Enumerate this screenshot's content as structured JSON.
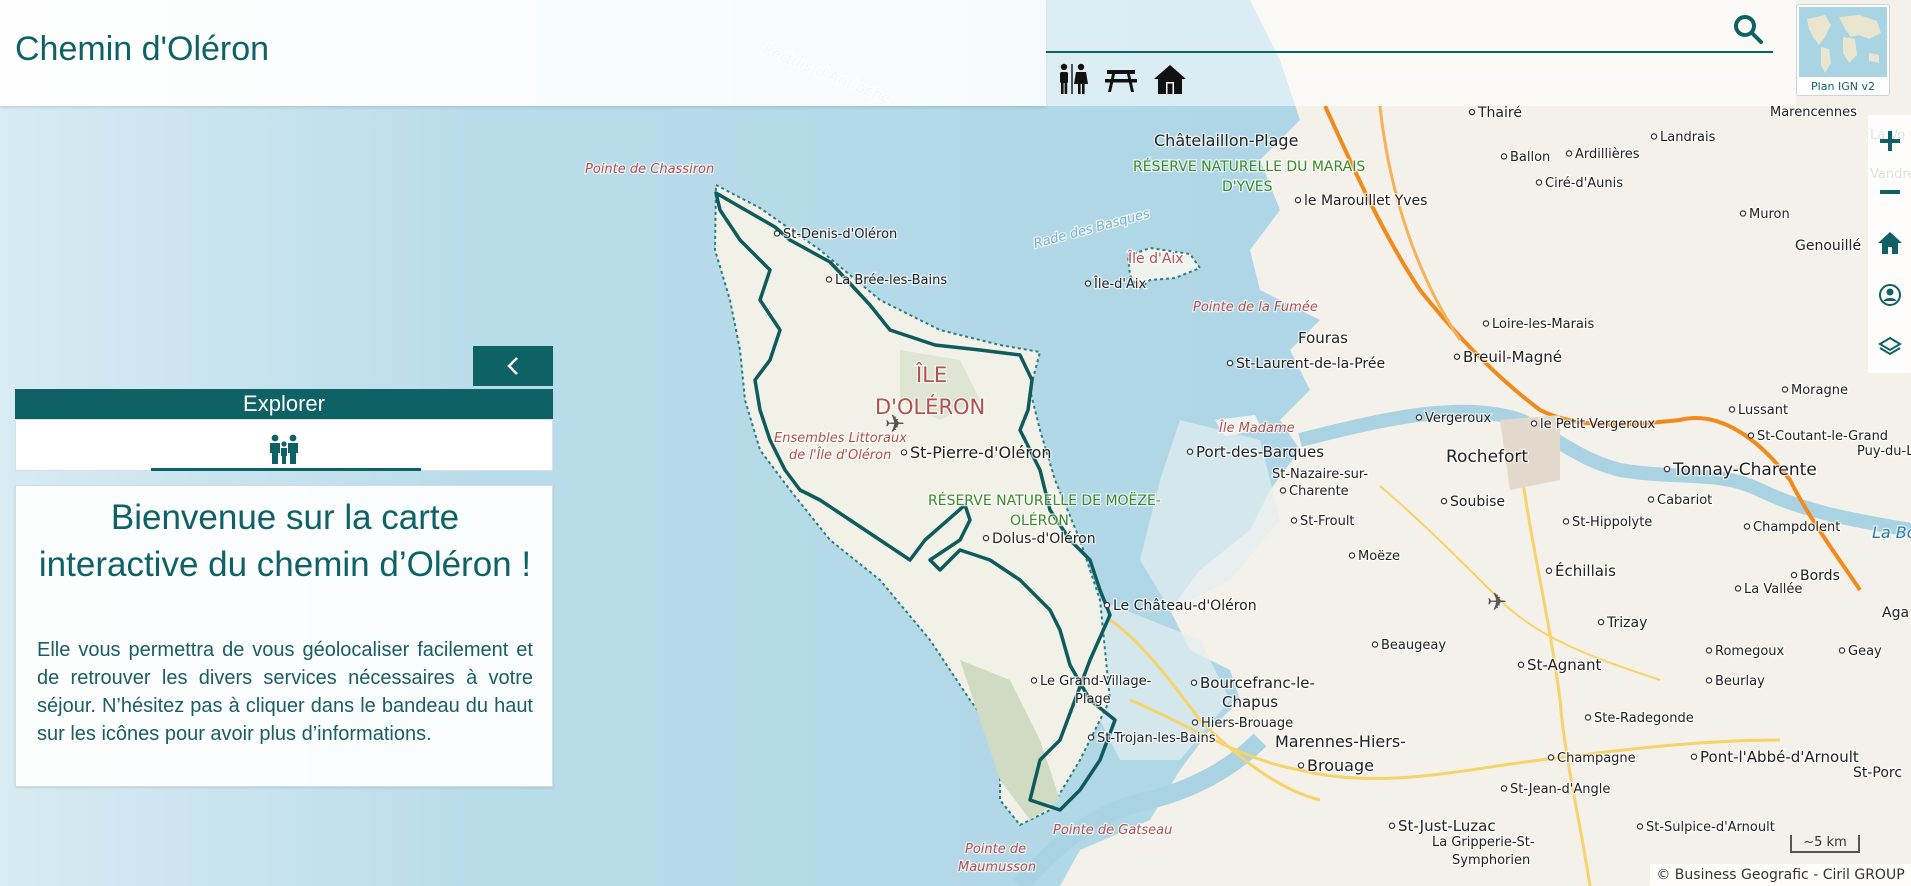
{
  "header": {
    "title": "Chemin d'Oléron"
  },
  "search": {
    "placeholder": "",
    "icon": "search-icon"
  },
  "services": [
    {
      "icon": "restroom-icon"
    },
    {
      "icon": "picnic-table-icon"
    },
    {
      "icon": "house-icon"
    }
  ],
  "basemap": {
    "label": "Plan IGN v2"
  },
  "controls": [
    "zoom-in-icon",
    "zoom-out-icon",
    "home-icon",
    "geolocate-icon",
    "layers-icon"
  ],
  "sidebar": {
    "explorer_title": "Explorer",
    "tab_icon": "family-icon",
    "welcome_title": "Bienvenue sur la carte interactive du chemin d’Oléron !",
    "welcome_text": "Elle vous permettra de vous géolocaliser facilement et de retrouver les divers services nécessaires à votre séjour. N’hésitez pas à cliquer dans le bandeau du haut sur les icônes pour avoir plus d’informations."
  },
  "map": {
    "labels": {
      "pertuis": "Pertuis d'Antioche",
      "pointe_chassiron": "Pointe de Chassiron",
      "st_denis": "St-Denis-d'Oléron",
      "la_bree": "La Brée-les-Bains",
      "ile_oleron": "ÎLE D'OLÉRON",
      "ensembles": "Ensembles Littoraux de l'Île d'Oléron",
      "st_pierre": "St-Pierre-d'Oléron",
      "reserve_moeze": "RÉSERVE NATURELLE DE MOËZE-OLÉRON",
      "dolus": "Dolus-d'Oléron",
      "chateau": "Le Château-d'Oléron",
      "grand_village": "Le Grand-Village-Plage",
      "st_trojan": "St-Trojan-les-Bains",
      "pointe_gatseau": "Pointe de Gatseau",
      "pointe_maumusson": "Pointe de Maumusson",
      "rade_basques": "Rade des Basques",
      "ile_aix_area": "Île d'Aix",
      "ile_aix": "Île-d'Aix",
      "pointe_fumee": "Pointe de la Fumée",
      "fouras": "Fouras",
      "st_laurent": "St-Laurent-de-la-Prée",
      "ile_madame": "Île Madame",
      "port_barques": "Port-des-Barques",
      "st_nazaire": "St-Nazaire-sur-Charente",
      "st_froult": "St-Froult",
      "moeze": "Moëze",
      "bourcefranc": "Bourcefranc-le-Chapus",
      "hiers_brouage": "Hiers-Brouage",
      "marennes": "Marennes-Hiers-Brouage",
      "st_just": "St-Just-Luzac",
      "gripperie": "La Gripperie-St-Symphorien",
      "beaugeay": "Beaugeay",
      "chatelaillon": "Châtelaillon-Plage",
      "reserve_yves": "RÉSERVE NATURELLE DU MARAIS D'YVES",
      "marouillet": "le Marouillet Yves",
      "thaire": "Thairé",
      "ballon": "Ballon",
      "ardillieres": "Ardillières",
      "landrais": "Landrais",
      "cire": "Ciré-d'Aunis",
      "loire_marais": "Loire-les-Marais",
      "breuil": "Breuil-Magné",
      "vergeroux": "Vergeroux",
      "petit_vergeroux": "le Petit Vergeroux",
      "rochefort": "Rochefort",
      "soubise": "Soubise",
      "tonnay": "Tonnay-Charente",
      "cabariot": "Cabariot",
      "st_hippolyte": "St-Hippolyte",
      "echillais": "Échillais",
      "st_agnant": "St-Agnant",
      "trizay": "Trizay",
      "champagne": "Champagne",
      "ste_radegonde": "Ste-Radegonde",
      "st_jean_angle": "St-Jean-d'Angle",
      "pont_abbe": "Pont-l'Abbé-d'Arnoult",
      "st_sulpice": "St-Sulpice-d'Arnoult",
      "beurlay": "Beurlay",
      "romegoux": "Romegoux",
      "la_vallee": "La Vallée",
      "bords": "Bords",
      "muron": "Muron",
      "genouille": "Genouillé",
      "marencennes": "Marencennes",
      "moragne": "Moragne",
      "lussant": "Lussant",
      "st_coutant": "St-Coutant-le-Grand",
      "champdolent": "Champdolent",
      "puy_du_lac": "Puy-du-Lac",
      "la_bou": "La Bou",
      "geay": "Geay",
      "st_porc": "St-Porc",
      "la_vo": "La Vo",
      "vandre": "Vandré",
      "aga": "Aga"
    }
  },
  "scale": "~5 km",
  "attribution": "© Business Geografic - Ciril GROUP",
  "colors": {
    "accent": "#0e6266",
    "sea": "#a9d3e3",
    "land": "#f4f2eb",
    "trail": "#0e5a5c",
    "road_major": "#f08a1c"
  }
}
